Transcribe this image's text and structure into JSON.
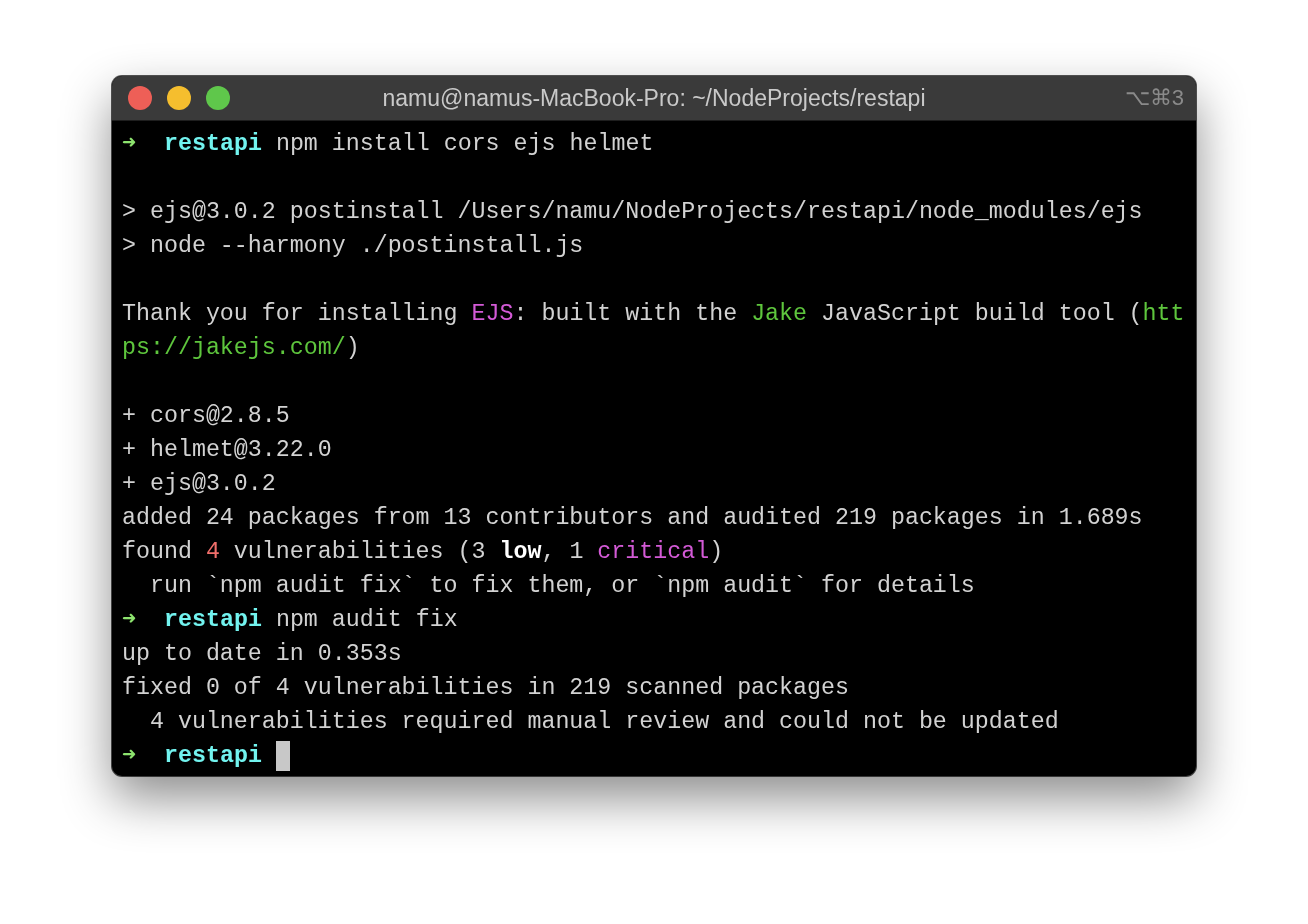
{
  "window": {
    "title": "namu@namus-MacBook-Pro: ~/NodeProjects/restapi",
    "shortcut": "⌥⌘3"
  },
  "lines": [
    {
      "kind": "prompt",
      "segments": [
        {
          "kind": "arrow",
          "text": "➜"
        },
        {
          "kind": "dir",
          "text": "restapi"
        },
        {
          "kind": "command",
          "text": "npm install cors ejs helmet"
        }
      ]
    },
    {
      "kind": "blank"
    },
    {
      "kind": "output",
      "segments": [
        {
          "kind": "plain",
          "text": "> ejs@3.0.2 postinstall /Users/namu/NodeProjects/restapi/node_modules/ejs"
        }
      ]
    },
    {
      "kind": "output",
      "segments": [
        {
          "kind": "plain",
          "text": "> node --harmony ./postinstall.js"
        }
      ]
    },
    {
      "kind": "blank"
    },
    {
      "kind": "output",
      "segments": [
        {
          "kind": "plain",
          "text": "Thank you for installing "
        },
        {
          "kind": "magenta",
          "text": "EJS"
        },
        {
          "kind": "plain",
          "text": ": built with the "
        },
        {
          "kind": "green",
          "text": "Jake"
        },
        {
          "kind": "plain",
          "text": " JavaScript build tool ("
        },
        {
          "kind": "green",
          "text": "htt"
        }
      ]
    },
    {
      "kind": "output",
      "segments": [
        {
          "kind": "green",
          "text": "ps://jakejs.com/"
        },
        {
          "kind": "plain",
          "text": ")"
        }
      ]
    },
    {
      "kind": "blank"
    },
    {
      "kind": "output",
      "segments": [
        {
          "kind": "plain",
          "text": "+ cors@2.8.5"
        }
      ]
    },
    {
      "kind": "output",
      "segments": [
        {
          "kind": "plain",
          "text": "+ helmet@3.22.0"
        }
      ]
    },
    {
      "kind": "output",
      "segments": [
        {
          "kind": "plain",
          "text": "+ ejs@3.0.2"
        }
      ]
    },
    {
      "kind": "output",
      "segments": [
        {
          "kind": "plain",
          "text": "added 24 packages from 13 contributors and audited 219 packages in 1.689s"
        }
      ]
    },
    {
      "kind": "output",
      "segments": [
        {
          "kind": "plain",
          "text": "found "
        },
        {
          "kind": "red",
          "text": "4"
        },
        {
          "kind": "plain",
          "text": " vulnerabilities (3 "
        },
        {
          "kind": "bold",
          "text": "low"
        },
        {
          "kind": "plain",
          "text": ", 1 "
        },
        {
          "kind": "magenta",
          "text": "critical"
        },
        {
          "kind": "plain",
          "text": ")"
        }
      ]
    },
    {
      "kind": "output",
      "segments": [
        {
          "kind": "plain",
          "text": "  run `npm audit fix` to fix them, or `npm audit` for details"
        }
      ]
    },
    {
      "kind": "prompt",
      "segments": [
        {
          "kind": "arrow",
          "text": "➜"
        },
        {
          "kind": "dir",
          "text": "restapi"
        },
        {
          "kind": "command",
          "text": "npm audit fix"
        }
      ]
    },
    {
      "kind": "output",
      "segments": [
        {
          "kind": "plain",
          "text": "up to date in 0.353s"
        }
      ]
    },
    {
      "kind": "output",
      "segments": [
        {
          "kind": "plain",
          "text": "fixed 0 of 4 vulnerabilities in 219 scanned packages"
        }
      ]
    },
    {
      "kind": "output",
      "segments": [
        {
          "kind": "plain",
          "text": "  4 vulnerabilities required manual review and could not be updated"
        }
      ]
    },
    {
      "kind": "prompt",
      "cursor": true,
      "segments": [
        {
          "kind": "arrow",
          "text": "➜"
        },
        {
          "kind": "dir",
          "text": "restapi"
        }
      ]
    }
  ]
}
